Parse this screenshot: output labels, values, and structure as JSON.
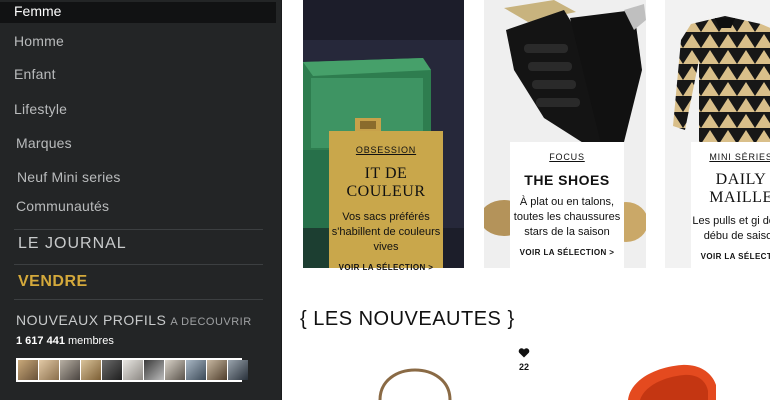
{
  "sidebar": {
    "active_item": "Femme",
    "items": [
      "Homme",
      "Enfant",
      "Lifestyle",
      "Marques",
      "Neuf  Mini series",
      "Communautés"
    ],
    "journal": "LE JOURNAL",
    "vendre": "VENDRE",
    "profiles_title": "NOUVEAUX PROFILS",
    "profiles_sub": "A DECOUVRIR",
    "members_count": "1 617 441",
    "members_label": "membres"
  },
  "tiles": [
    {
      "kicker": "OBSESSION",
      "title": "IT DE COULEUR",
      "description": "Vos sacs préférés s'habillent de couleurs vives",
      "cta": "VOIR LA SÉLECTION >"
    },
    {
      "kicker": "FOCUS",
      "title": "THE SHOES",
      "description": "À plat ou en talons, toutes les chaussures stars de la saison",
      "cta": "VOIR LA SÉLECTION >"
    },
    {
      "kicker": "MINI SÉRIES",
      "title": "DAILY MAILLE",
      "description": "Les pulls et gi de ce débu de saison",
      "cta": "VOIR LA SÉLECTIO"
    }
  ],
  "nouveautes": {
    "title": "{ LES NOUVEAUTES }",
    "likes": "22"
  },
  "colors": {
    "sidebar_bg": "#232526",
    "accent_gold": "#d4a93b",
    "card_gold": "#c9a74b"
  }
}
